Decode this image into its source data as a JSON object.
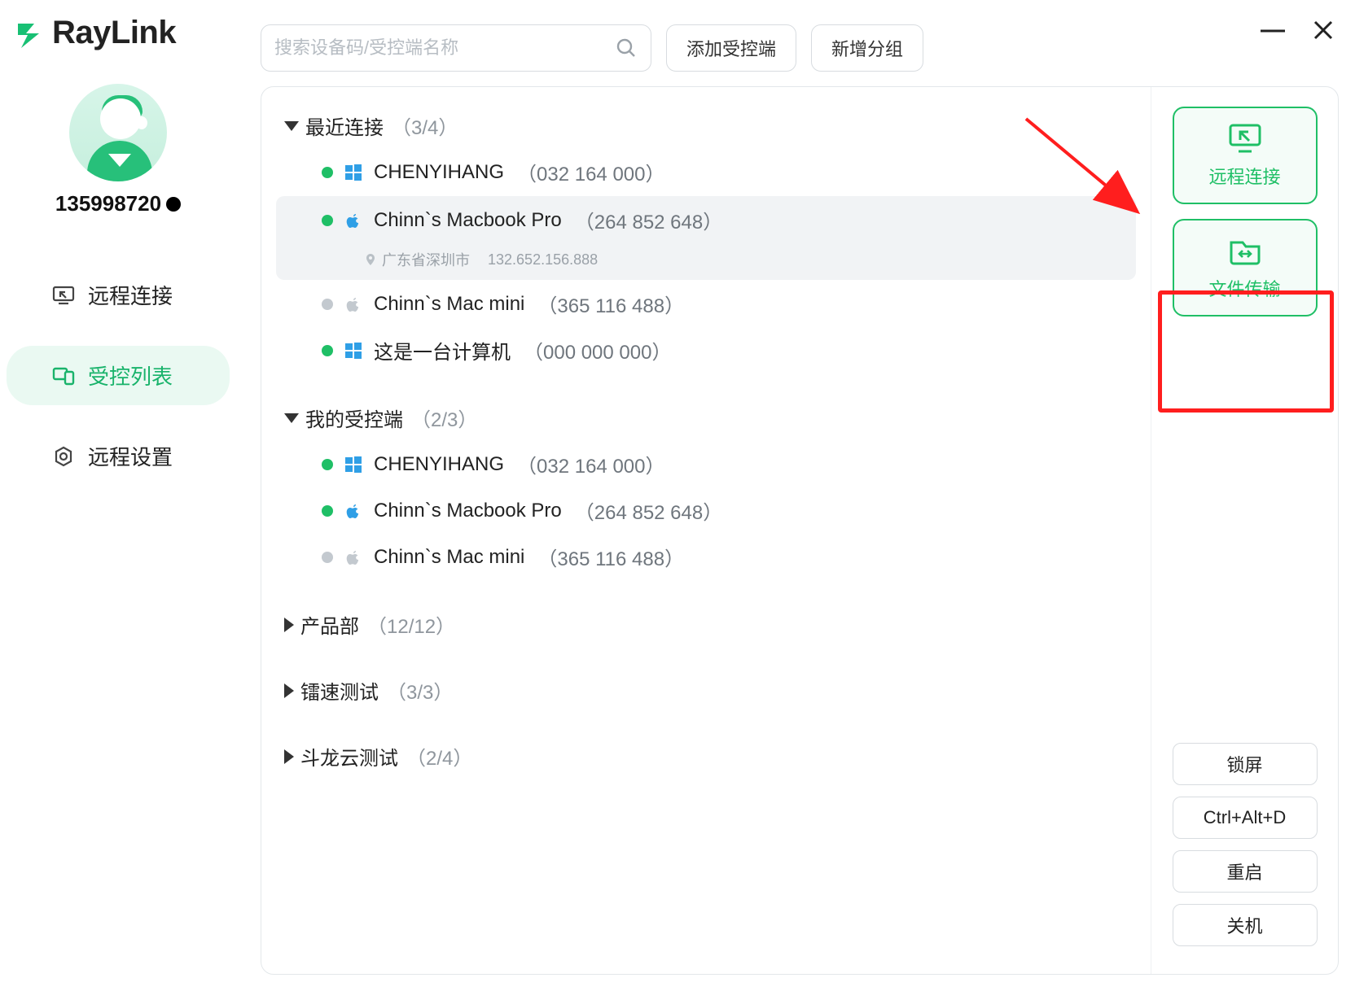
{
  "brand": "RayLink",
  "user": {
    "name": "135998720"
  },
  "sidebar": {
    "items": [
      {
        "label": "远程连接"
      },
      {
        "label": "受控列表"
      },
      {
        "label": "远程设置"
      }
    ],
    "activeIndex": 1
  },
  "topbar": {
    "search_placeholder": "搜索设备码/受控端名称",
    "add_device": "添加受控端",
    "add_group": "新增分组"
  },
  "actions": {
    "remote_connect": "远程连接",
    "file_transfer": "文件传输",
    "lock_screen": "锁屏",
    "ctrl_alt_d": "Ctrl+Alt+D",
    "restart": "重启",
    "shutdown": "关机"
  },
  "groups": [
    {
      "name": "最近连接",
      "count": "（3/4）",
      "expanded": true,
      "devices": [
        {
          "name": "CHENYIHANG",
          "id": "（032 164 000）",
          "os": "windows",
          "online": true
        },
        {
          "name": "Chinn`s Macbook Pro",
          "id": "（264 852 648）",
          "os": "apple",
          "online": true,
          "selected": true,
          "location": "广东省深圳市",
          "ip": "132.652.156.888"
        },
        {
          "name": "Chinn`s Mac mini",
          "id": "（365 116 488）",
          "os": "apple",
          "online": false
        },
        {
          "name": "这是一台计算机",
          "id": "（000 000 000）",
          "os": "windows",
          "online": true
        }
      ]
    },
    {
      "name": "我的受控端",
      "count": "（2/3）",
      "expanded": true,
      "devices": [
        {
          "name": "CHENYIHANG",
          "id": "（032 164 000）",
          "os": "windows",
          "online": true
        },
        {
          "name": "Chinn`s Macbook Pro",
          "id": "（264 852 648）",
          "os": "apple",
          "online": true
        },
        {
          "name": "Chinn`s Mac mini",
          "id": "（365 116 488）",
          "os": "apple",
          "online": false
        }
      ]
    },
    {
      "name": "产品部",
      "count": "（12/12）",
      "expanded": false
    },
    {
      "name": "镭速测试",
      "count": "（3/3）",
      "expanded": false
    },
    {
      "name": "斗龙云测试",
      "count": "（2/4）",
      "expanded": false
    }
  ]
}
